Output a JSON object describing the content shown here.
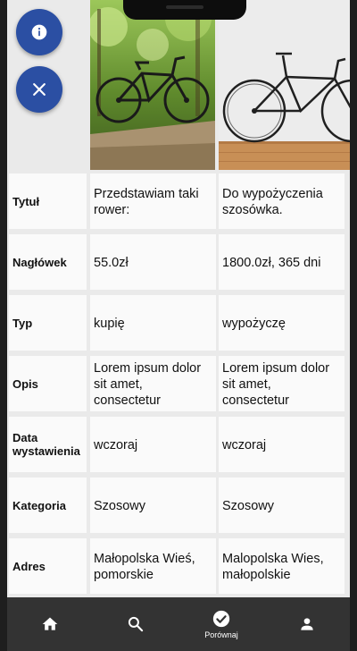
{
  "compare": {
    "rows": [
      {
        "label": "Tytuł",
        "v1": "Przedstawiam taki rower:",
        "v2": "Do wypożyczenia szosówka."
      },
      {
        "label": "Nagłówek",
        "v1": "55.0zł",
        "v2": "1800.0zł, 365 dni"
      },
      {
        "label": "Typ",
        "v1": "kupię",
        "v2": "wypożyczę"
      },
      {
        "label": "Opis",
        "v1": "Lorem ipsum dolor sit amet, consectetur",
        "v2": "Lorem ipsum dolor sit amet, consectetur"
      },
      {
        "label": "Data wystawienia",
        "v1": "wczoraj",
        "v2": "wczoraj"
      },
      {
        "label": "Kategoria",
        "v1": "Szosowy",
        "v2": "Szosowy"
      },
      {
        "label": "Adres",
        "v1": "Małopolska Wieś, pomorskie",
        "v2": "Malopolska Wies, małopolskie"
      }
    ]
  },
  "bottom_nav": {
    "items": [
      {
        "icon": "home-icon",
        "label": ""
      },
      {
        "icon": "search-icon",
        "label": ""
      },
      {
        "icon": "check-circle-icon",
        "label": "Porównaj"
      },
      {
        "icon": "person-icon",
        "label": ""
      }
    ]
  },
  "colors": {
    "fab": "#2b4fa3",
    "nav_bg": "#333333",
    "cell_bg": "#fafafa"
  }
}
